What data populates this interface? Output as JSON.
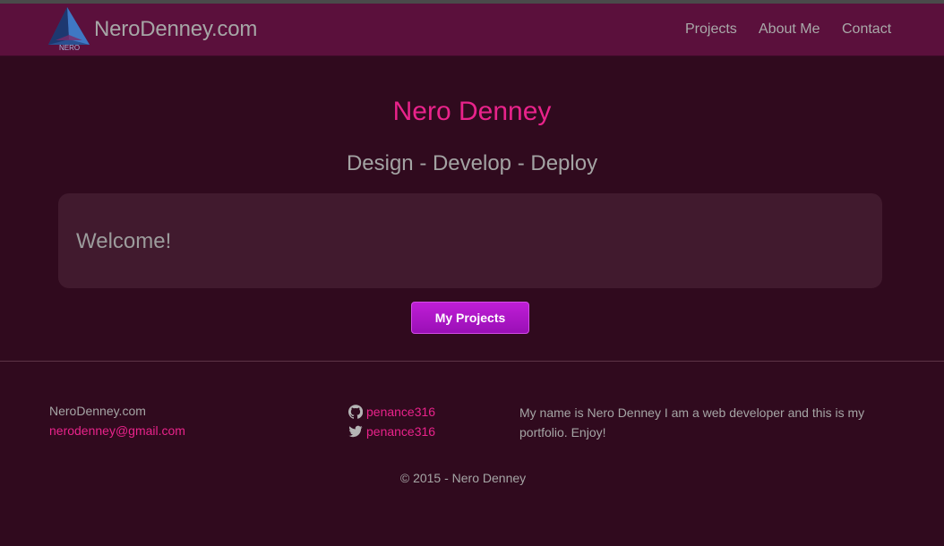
{
  "navbar": {
    "logo_text": "NERO",
    "brand": "NeroDenney.com",
    "links": [
      "Projects",
      "About Me",
      "Contact"
    ]
  },
  "hero": {
    "title": "Nero Denney",
    "subtitle": "Design - Develop - Deploy",
    "welcome": "Welcome!",
    "button_label": "My Projects"
  },
  "footer": {
    "site": "NeroDenney.com",
    "email": "nerodenney@gmail.com",
    "github": "penance316",
    "twitter": "penance316",
    "about": "My name is Nero Denney I am a web developer and this is my portfolio. Enjoy!",
    "copyright": "© 2015 - Nero Denney"
  },
  "colors": {
    "background": "#300a1e",
    "navbar": "#5b103c",
    "accent": "#e9238b",
    "button": "#b01ac8",
    "panel": "#411a2e"
  },
  "icons": [
    "nero-logo-icon",
    "github-icon",
    "twitter-icon"
  ]
}
